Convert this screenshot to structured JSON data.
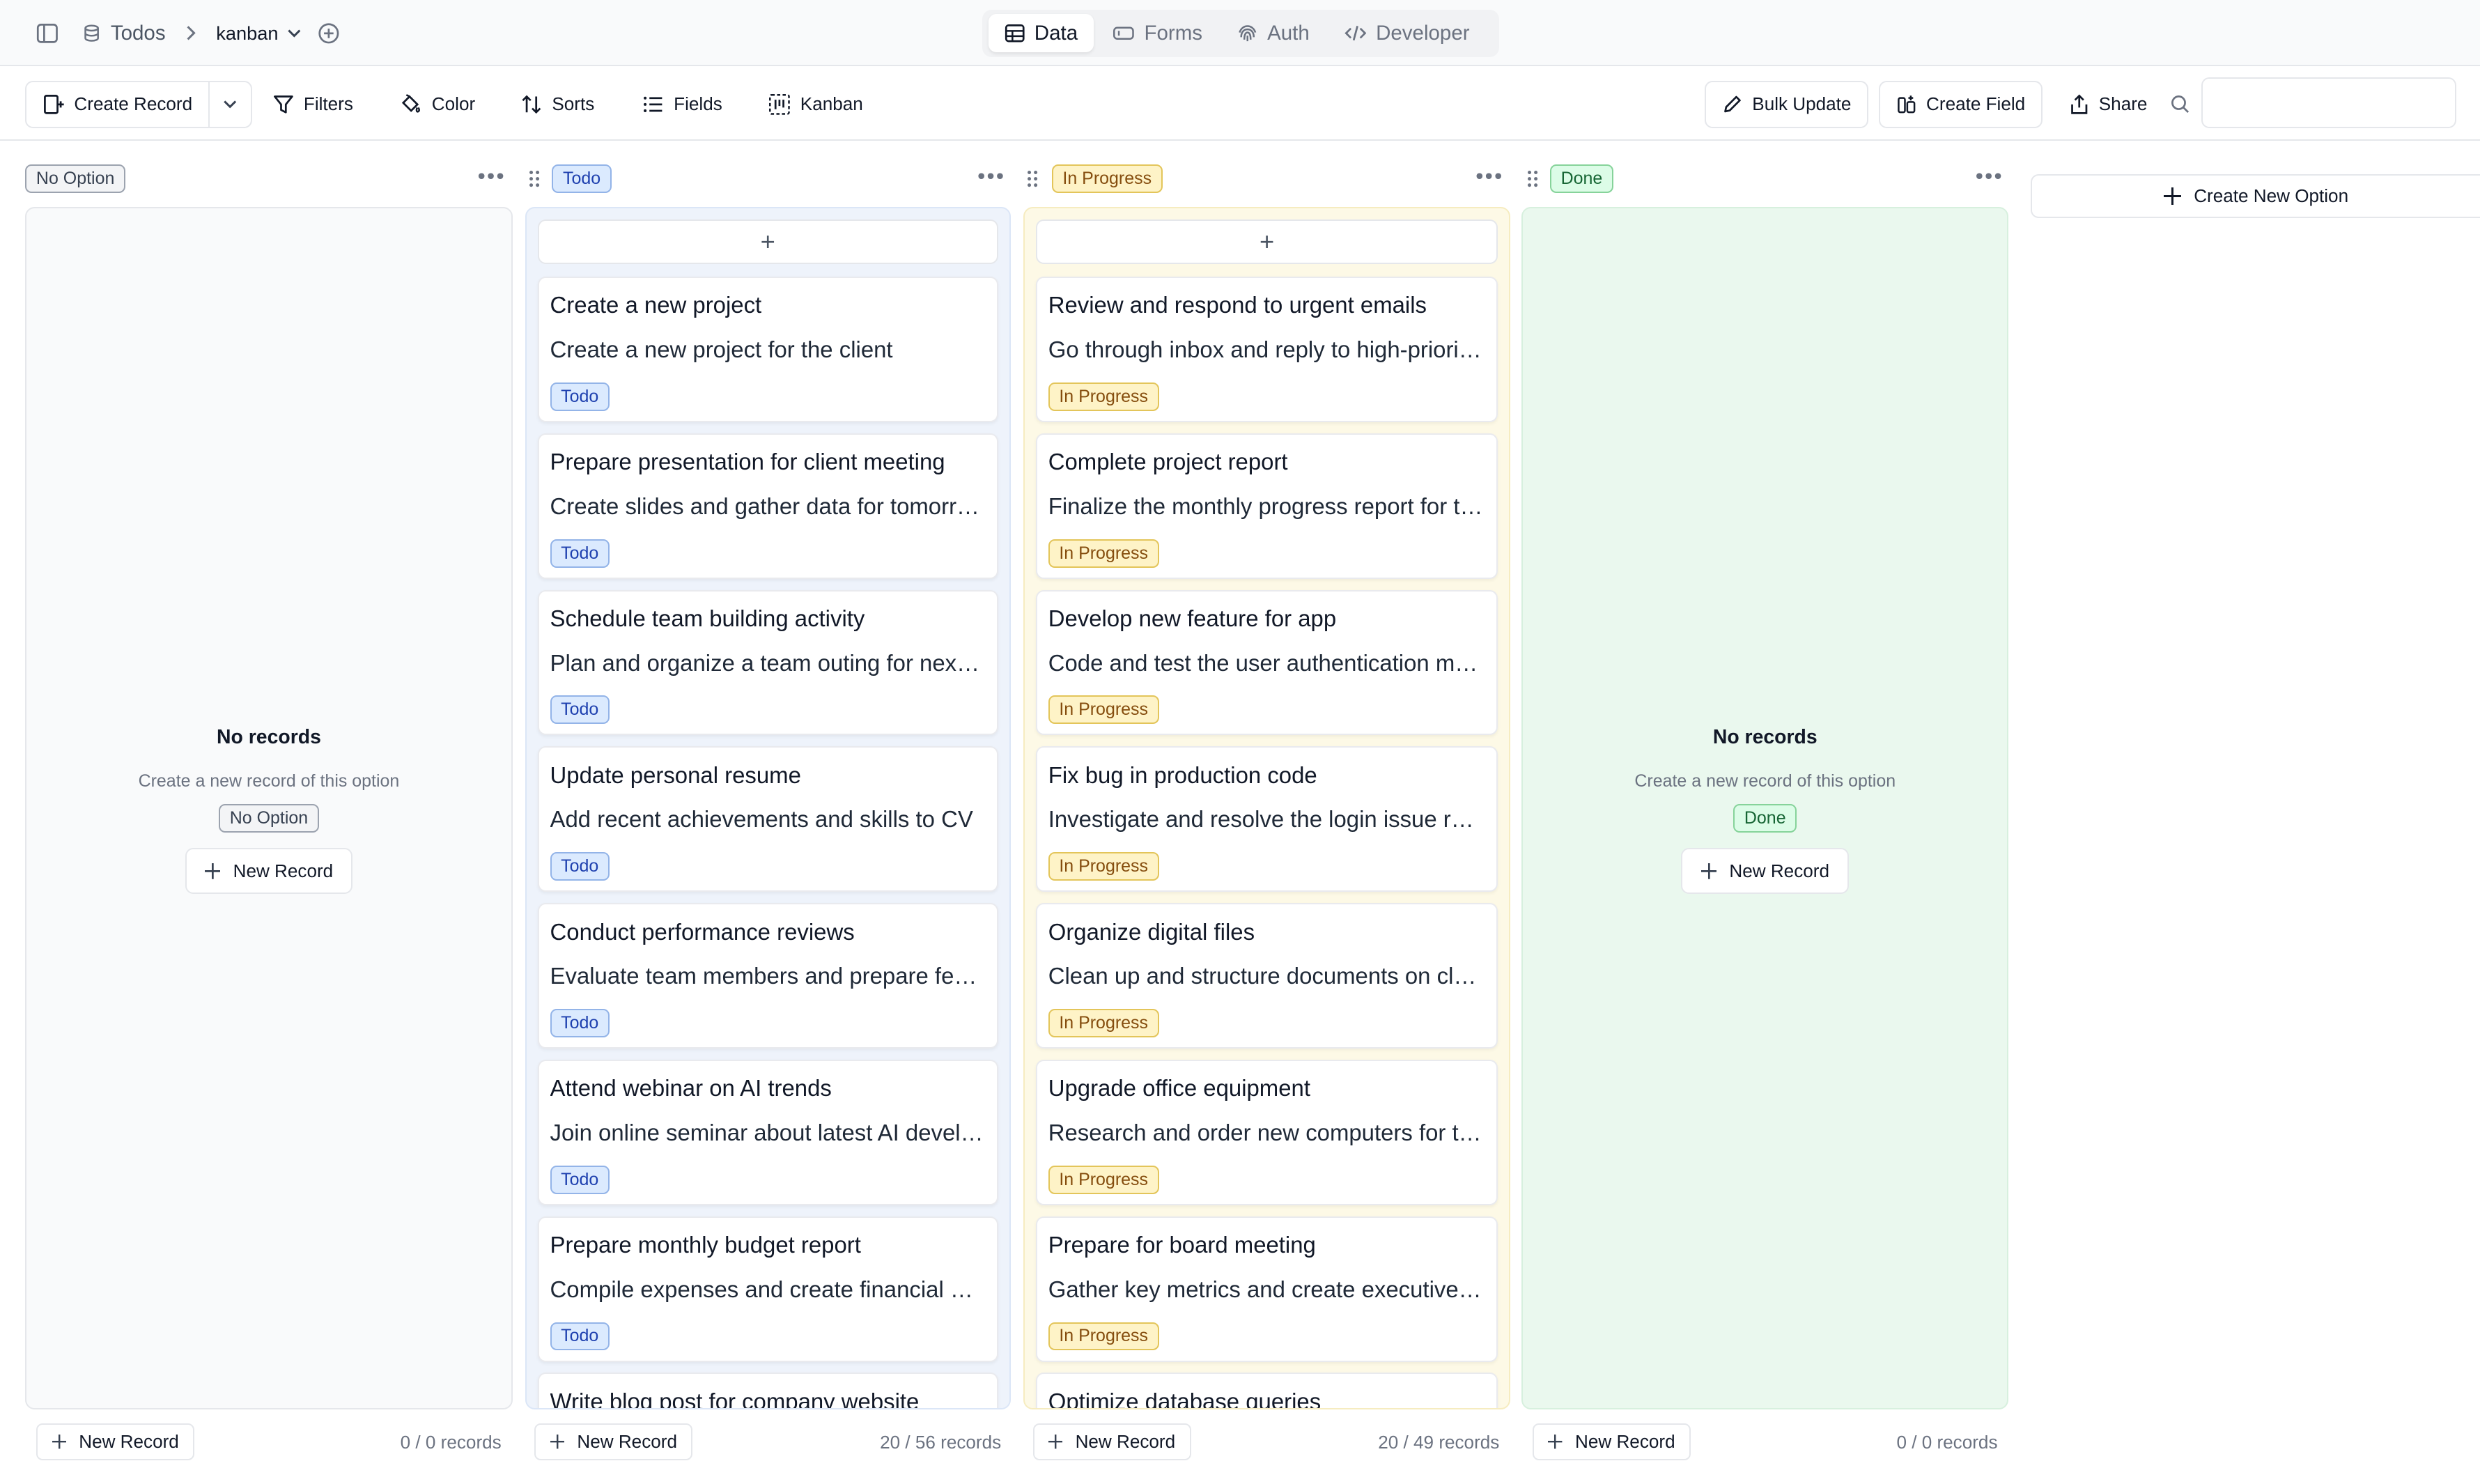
{
  "topbar": {
    "table_name": "Todos",
    "view_name": "kanban",
    "tabs": [
      "Data",
      "Forms",
      "Auth",
      "Developer"
    ]
  },
  "toolbar": {
    "create_record": "Create Record",
    "filters": "Filters",
    "color": "Color",
    "sorts": "Sorts",
    "fields": "Fields",
    "kanban": "Kanban",
    "bulk_update": "Bulk Update",
    "create_field": "Create Field",
    "share": "Share",
    "search_value": ""
  },
  "columns": [
    {
      "label": "No Option",
      "style": "none",
      "empty_title": "No records",
      "empty_sub": "Create a new record of this option",
      "new_record": "New Record",
      "count": "0 / 0 records",
      "cards": []
    },
    {
      "label": "Todo",
      "style": "todo",
      "new_record": "New Record",
      "count": "20 / 56 records",
      "cards": [
        {
          "title": "Create a new project",
          "desc": "Create a new project for the client"
        },
        {
          "title": "Prepare presentation for client meeting",
          "desc": "Create slides and gather data for tomorrow's meeting"
        },
        {
          "title": "Schedule team building activity",
          "desc": "Plan and organize a team outing for next month"
        },
        {
          "title": "Update personal resume",
          "desc": "Add recent achievements and skills to CV"
        },
        {
          "title": "Conduct performance reviews",
          "desc": "Evaluate team members and prepare feedback"
        },
        {
          "title": "Attend webinar on AI trends",
          "desc": "Join online seminar about latest AI developments"
        },
        {
          "title": "Prepare monthly budget report",
          "desc": "Compile expenses and create financial summary"
        },
        {
          "title": "Write blog post for company website",
          "desc": ""
        }
      ]
    },
    {
      "label": "In Progress",
      "style": "prog",
      "new_record": "New Record",
      "count": "20 / 49 records",
      "cards": [
        {
          "title": "Review and respond to urgent emails",
          "desc": "Go through inbox and reply to high-priority messages"
        },
        {
          "title": "Complete project report",
          "desc": "Finalize the monthly progress report for the team"
        },
        {
          "title": "Develop new feature for app",
          "desc": "Code and test the user authentication module"
        },
        {
          "title": "Fix bug in production code",
          "desc": "Investigate and resolve the login issue reported"
        },
        {
          "title": "Organize digital files",
          "desc": "Clean up and structure documents on cloud storage"
        },
        {
          "title": "Upgrade office equipment",
          "desc": "Research and order new computers for the team"
        },
        {
          "title": "Prepare for board meeting",
          "desc": "Gather key metrics and create executive summary"
        },
        {
          "title": "Optimize database queries",
          "desc": ""
        }
      ]
    },
    {
      "label": "Done",
      "style": "done",
      "empty_title": "No records",
      "empty_sub": "Create a new record of this option",
      "new_record": "New Record",
      "count": "0 / 0 records",
      "cards": []
    }
  ],
  "create_new_option": "Create New Option"
}
